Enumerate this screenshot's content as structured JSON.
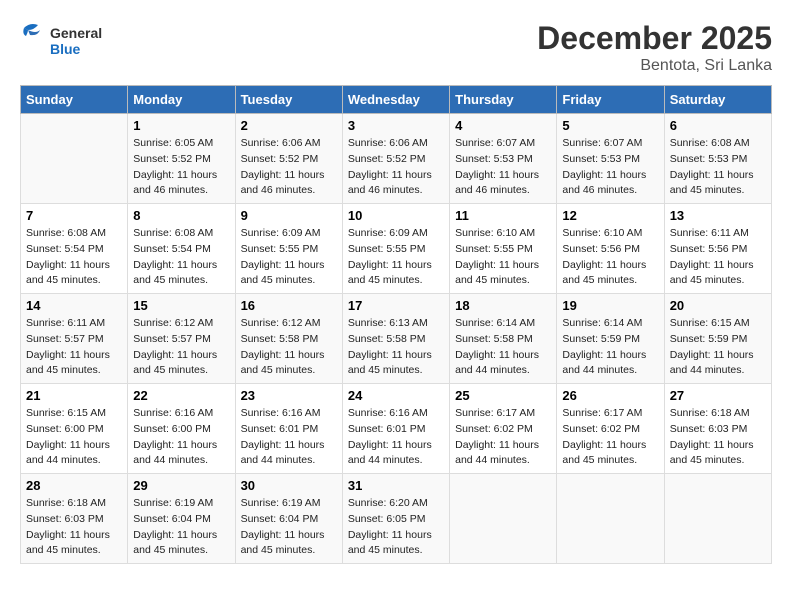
{
  "logo": {
    "general": "General",
    "blue": "Blue"
  },
  "title": "December 2025",
  "subtitle": "Bentota, Sri Lanka",
  "days_of_week": [
    "Sunday",
    "Monday",
    "Tuesday",
    "Wednesday",
    "Thursday",
    "Friday",
    "Saturday"
  ],
  "weeks": [
    [
      {
        "day": "",
        "info": ""
      },
      {
        "day": "1",
        "info": "Sunrise: 6:05 AM\nSunset: 5:52 PM\nDaylight: 11 hours\nand 46 minutes."
      },
      {
        "day": "2",
        "info": "Sunrise: 6:06 AM\nSunset: 5:52 PM\nDaylight: 11 hours\nand 46 minutes."
      },
      {
        "day": "3",
        "info": "Sunrise: 6:06 AM\nSunset: 5:52 PM\nDaylight: 11 hours\nand 46 minutes."
      },
      {
        "day": "4",
        "info": "Sunrise: 6:07 AM\nSunset: 5:53 PM\nDaylight: 11 hours\nand 46 minutes."
      },
      {
        "day": "5",
        "info": "Sunrise: 6:07 AM\nSunset: 5:53 PM\nDaylight: 11 hours\nand 46 minutes."
      },
      {
        "day": "6",
        "info": "Sunrise: 6:08 AM\nSunset: 5:53 PM\nDaylight: 11 hours\nand 45 minutes."
      }
    ],
    [
      {
        "day": "7",
        "info": "Sunrise: 6:08 AM\nSunset: 5:54 PM\nDaylight: 11 hours\nand 45 minutes."
      },
      {
        "day": "8",
        "info": "Sunrise: 6:08 AM\nSunset: 5:54 PM\nDaylight: 11 hours\nand 45 minutes."
      },
      {
        "day": "9",
        "info": "Sunrise: 6:09 AM\nSunset: 5:55 PM\nDaylight: 11 hours\nand 45 minutes."
      },
      {
        "day": "10",
        "info": "Sunrise: 6:09 AM\nSunset: 5:55 PM\nDaylight: 11 hours\nand 45 minutes."
      },
      {
        "day": "11",
        "info": "Sunrise: 6:10 AM\nSunset: 5:55 PM\nDaylight: 11 hours\nand 45 minutes."
      },
      {
        "day": "12",
        "info": "Sunrise: 6:10 AM\nSunset: 5:56 PM\nDaylight: 11 hours\nand 45 minutes."
      },
      {
        "day": "13",
        "info": "Sunrise: 6:11 AM\nSunset: 5:56 PM\nDaylight: 11 hours\nand 45 minutes."
      }
    ],
    [
      {
        "day": "14",
        "info": "Sunrise: 6:11 AM\nSunset: 5:57 PM\nDaylight: 11 hours\nand 45 minutes."
      },
      {
        "day": "15",
        "info": "Sunrise: 6:12 AM\nSunset: 5:57 PM\nDaylight: 11 hours\nand 45 minutes."
      },
      {
        "day": "16",
        "info": "Sunrise: 6:12 AM\nSunset: 5:58 PM\nDaylight: 11 hours\nand 45 minutes."
      },
      {
        "day": "17",
        "info": "Sunrise: 6:13 AM\nSunset: 5:58 PM\nDaylight: 11 hours\nand 45 minutes."
      },
      {
        "day": "18",
        "info": "Sunrise: 6:14 AM\nSunset: 5:58 PM\nDaylight: 11 hours\nand 44 minutes."
      },
      {
        "day": "19",
        "info": "Sunrise: 6:14 AM\nSunset: 5:59 PM\nDaylight: 11 hours\nand 44 minutes."
      },
      {
        "day": "20",
        "info": "Sunrise: 6:15 AM\nSunset: 5:59 PM\nDaylight: 11 hours\nand 44 minutes."
      }
    ],
    [
      {
        "day": "21",
        "info": "Sunrise: 6:15 AM\nSunset: 6:00 PM\nDaylight: 11 hours\nand 44 minutes."
      },
      {
        "day": "22",
        "info": "Sunrise: 6:16 AM\nSunset: 6:00 PM\nDaylight: 11 hours\nand 44 minutes."
      },
      {
        "day": "23",
        "info": "Sunrise: 6:16 AM\nSunset: 6:01 PM\nDaylight: 11 hours\nand 44 minutes."
      },
      {
        "day": "24",
        "info": "Sunrise: 6:16 AM\nSunset: 6:01 PM\nDaylight: 11 hours\nand 44 minutes."
      },
      {
        "day": "25",
        "info": "Sunrise: 6:17 AM\nSunset: 6:02 PM\nDaylight: 11 hours\nand 44 minutes."
      },
      {
        "day": "26",
        "info": "Sunrise: 6:17 AM\nSunset: 6:02 PM\nDaylight: 11 hours\nand 45 minutes."
      },
      {
        "day": "27",
        "info": "Sunrise: 6:18 AM\nSunset: 6:03 PM\nDaylight: 11 hours\nand 45 minutes."
      }
    ],
    [
      {
        "day": "28",
        "info": "Sunrise: 6:18 AM\nSunset: 6:03 PM\nDaylight: 11 hours\nand 45 minutes."
      },
      {
        "day": "29",
        "info": "Sunrise: 6:19 AM\nSunset: 6:04 PM\nDaylight: 11 hours\nand 45 minutes."
      },
      {
        "day": "30",
        "info": "Sunrise: 6:19 AM\nSunset: 6:04 PM\nDaylight: 11 hours\nand 45 minutes."
      },
      {
        "day": "31",
        "info": "Sunrise: 6:20 AM\nSunset: 6:05 PM\nDaylight: 11 hours\nand 45 minutes."
      },
      {
        "day": "",
        "info": ""
      },
      {
        "day": "",
        "info": ""
      },
      {
        "day": "",
        "info": ""
      }
    ]
  ]
}
